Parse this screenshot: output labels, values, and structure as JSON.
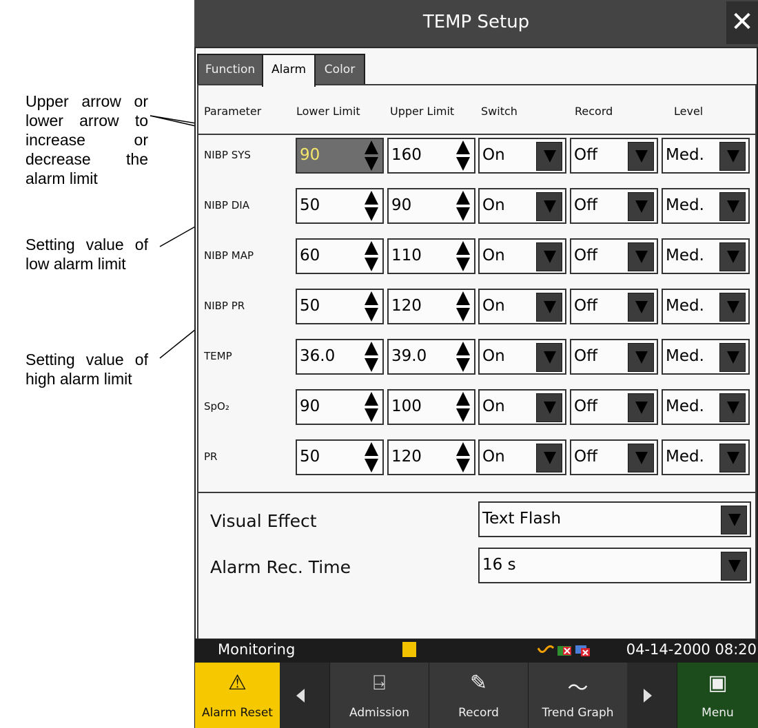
{
  "annotations": [
    "Upper arrow or lower arrow to increase or decrease the alarm limit",
    "Setting value of low alarm limit",
    "Setting value of high alarm limit"
  ],
  "dialog": {
    "title": "TEMP Setup",
    "close": "✕",
    "tabs": [
      "Function",
      "Alarm",
      "Color"
    ],
    "active_tab": "Alarm",
    "headers": [
      "Parameter",
      "Lower Limit",
      "Upper Limit",
      "Switch",
      "Record",
      "Level"
    ],
    "rows": [
      {
        "param": "NIBP SYS",
        "lower": "90",
        "upper": "160",
        "switch": "On",
        "record": "Off",
        "level": "Med."
      },
      {
        "param": "NIBP DIA",
        "lower": "50",
        "upper": "90",
        "switch": "On",
        "record": "Off",
        "level": "Med."
      },
      {
        "param": "NIBP MAP",
        "lower": "60",
        "upper": "110",
        "switch": "On",
        "record": "Off",
        "level": "Med."
      },
      {
        "param": "NIBP PR",
        "lower": "50",
        "upper": "120",
        "switch": "On",
        "record": "Off",
        "level": "Med."
      },
      {
        "param": "TEMP",
        "lower": "36.0",
        "upper": "39.0",
        "switch": "On",
        "record": "Off",
        "level": "Med."
      },
      {
        "param": "SpO₂",
        "lower": "90",
        "upper": "100",
        "switch": "On",
        "record": "Off",
        "level": "Med."
      },
      {
        "param": "PR",
        "lower": "50",
        "upper": "120",
        "switch": "On",
        "record": "Off",
        "level": "Med."
      }
    ],
    "visual_effect": {
      "label": "Visual Effect",
      "value": "Text Flash"
    },
    "alarm_rec_time": {
      "label": "Alarm Rec. Time",
      "value": "16 s"
    }
  },
  "status": {
    "mode": "Monitoring",
    "datetime": "04-14-2000 08:20"
  },
  "nav": {
    "alarm_reset": "Alarm Reset",
    "admission": "Admission",
    "record": "Record",
    "trend_graph": "Trend Graph",
    "menu": "Menu"
  },
  "colors": {
    "selected_value": "#f5e66a",
    "alarm_reset_bg": "#f6c800",
    "menu_bg": "#1c4b1c",
    "titlebar_bg": "#444444"
  }
}
